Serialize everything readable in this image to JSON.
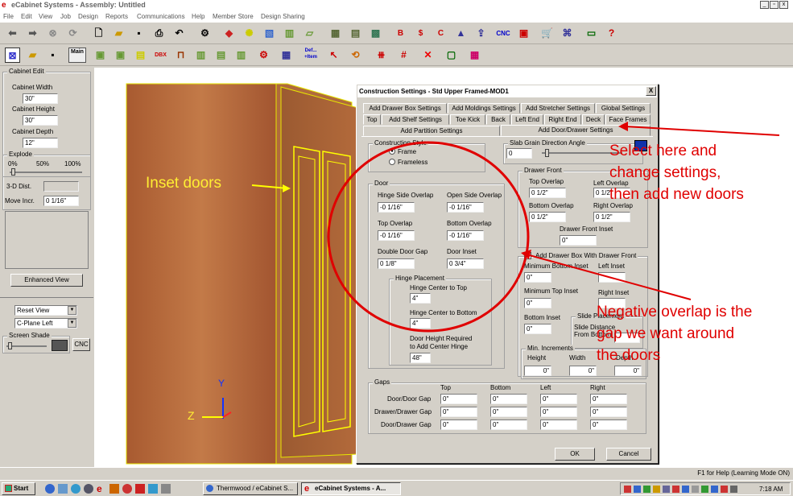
{
  "window": {
    "title": "eCabinet Systems - Assembly: Untitled"
  },
  "menu": [
    "File",
    "Edit",
    "View",
    "Job",
    "Design",
    "Reports",
    "Communications",
    "Help",
    "Member Store",
    "Design Sharing"
  ],
  "toolbar_icons": [
    "back-icon",
    "forward-icon",
    "stop-icon",
    "refresh-icon",
    "new-icon",
    "open-icon",
    "save-icon",
    "print-icon",
    "undo-icon",
    "settings-icon",
    "paint-icon",
    "lights-icon",
    "texture-icon",
    "door-icon",
    "part-icon",
    "cabinet-icon",
    "cabinet2-icon",
    "grid-icon",
    "bid-icon",
    "cost-icon",
    "cutlist-icon",
    "export-icon",
    "upload-icon",
    "cnc-icon",
    "flag-icon",
    "cart-icon",
    "network-icon",
    "screen-icon",
    "help-icon"
  ],
  "toolbar2": {
    "main": "Main",
    "dbx": "DBX",
    "def": "Def...",
    "item": "+Item"
  },
  "left_panel": {
    "title": "Cabinet Edit",
    "cabinet_width_label": "Cabinet Width",
    "cabinet_width": "30\"",
    "cabinet_height_label": "Cabinet Height",
    "cabinet_height": "30\"",
    "cabinet_depth_label": "Cabinet Depth",
    "cabinet_depth": "12\"",
    "explode_label": "Explode",
    "explode_0": "0%",
    "explode_50": "50%",
    "explode_100": "100%",
    "dist_label": "3-D Dist.",
    "move_incr_label": "Move Incr.",
    "move_incr": "0 1/16\"",
    "enhanced_view": "Enhanced View",
    "reset_view": "Reset View",
    "cplane": "C-Plane Left",
    "screen_shade": "Screen Shade",
    "cnc": "CNC"
  },
  "viewport": {
    "label_inset": "Inset doors",
    "axis_y": "Y",
    "axis_z": "Z"
  },
  "dialog": {
    "title": "Construction Settings - Std Upper Framed-MOD1",
    "close": "X",
    "tabs_row1": [
      "Add Drawer Box Settings",
      "Add Moldings Settings",
      "Add Stretcher Settings",
      "Global Settings"
    ],
    "tabs_row2": [
      "Top",
      "Add Shelf Settings",
      "Toe Kick",
      "Back",
      "Left End",
      "Right End",
      "Deck",
      "Face Frames"
    ],
    "tabs_row3": [
      "Add Partition Settings",
      "Add Door/Drawer Settings"
    ],
    "construction_style": {
      "label": "Construction Style",
      "frame": "Frame",
      "frameless": "Frameless"
    },
    "slab_grain": {
      "label": "Slab Grain Direction Angle",
      "value": "0"
    },
    "door": {
      "label": "Door",
      "hinge_side_label": "Hinge Side Overlap",
      "hinge_side": "-0 1/16\"",
      "open_side_label": "Open Side Overlap",
      "open_side": "-0 1/16\"",
      "top_overlap_label": "Top Overlap",
      "top_overlap": "-0 1/16\"",
      "bottom_overlap_label": "Bottom Overlap",
      "bottom_overlap": "-0 1/16\"",
      "double_gap_label": "Double Door Gap",
      "double_gap": "0 1/8\"",
      "door_inset_label": "Door Inset",
      "door_inset": "0 3/4\""
    },
    "hinge": {
      "label": "Hinge Placement",
      "top_label": "Hinge Center to Top",
      "top": "4\"",
      "bottom_label": "Hinge Center to Bottom",
      "bottom": "4\"",
      "req_label1": "Door Height Required",
      "req_label2": "to Add Center Hinge",
      "req": "48\""
    },
    "drawer_front": {
      "label": "Drawer Front",
      "top_label": "Top Overlap",
      "top": "0 1/2\"",
      "left_label": "Left Overlap",
      "left": "0 1/2\"",
      "bottom_label": "Bottom Overlap",
      "bottom": "0 1/2\"",
      "right_label": "Right Overlap",
      "right": "0 1/2\"",
      "inset_label": "Drawer Front Inset",
      "inset": "0\""
    },
    "drawer_box": {
      "label": "Add Drawer Box With Drawer Front",
      "min_bottom_label": "Minimum Bottom Inset",
      "min_bottom": "0\"",
      "left_inset_label": "Left Inset",
      "min_top_label": "Minimum Top Inset",
      "min_top": "0\"",
      "right_inset_label": "Right Inset",
      "bottom_inset_label": "Bottom Inset",
      "bottom_inset": "0\"",
      "slide_label": "Slide Placement",
      "slide_dist1": "Slide Distance",
      "slide_dist2": "From Bottom"
    },
    "min_increments": {
      "label": "Min. Increments",
      "height_label": "Height",
      "height": "0\"",
      "width_label": "Width",
      "width": "0\"",
      "depth_label": "Depth",
      "depth": "0\""
    },
    "gaps": {
      "label": "Gaps",
      "cols": [
        "Top",
        "Bottom",
        "Left",
        "Right"
      ],
      "rows": [
        {
          "label": "Door/Door Gap",
          "values": [
            "0\"",
            "0\"",
            "0\"",
            "0\""
          ]
        },
        {
          "label": "Drawer/Drawer Gap",
          "values": [
            "0\"",
            "0\"",
            "0\"",
            "0\""
          ]
        },
        {
          "label": "Door/Drawer Gap",
          "values": [
            "0\"",
            "0\"",
            "0\"",
            "0\""
          ]
        }
      ]
    },
    "ok": "OK",
    "cancel": "Cancel"
  },
  "annotations": {
    "select_here": [
      "Select here and",
      "change settings,",
      "then add new doors"
    ],
    "negative": [
      "Negative overlap is the",
      "gap we want around",
      "the doors"
    ]
  },
  "status": {
    "help": "F1 for Help (Learning Mode ON)"
  },
  "taskbar": {
    "start": "Start",
    "task1": "Thermwood / eCabinet S...",
    "task2": "eCabinet Systems - A...",
    "clock": "7:18 AM"
  },
  "colors": {
    "annotation": "#e00000",
    "inset_label": "#ffee33",
    "wood": "#b4693a",
    "outline": "#ffff00"
  }
}
